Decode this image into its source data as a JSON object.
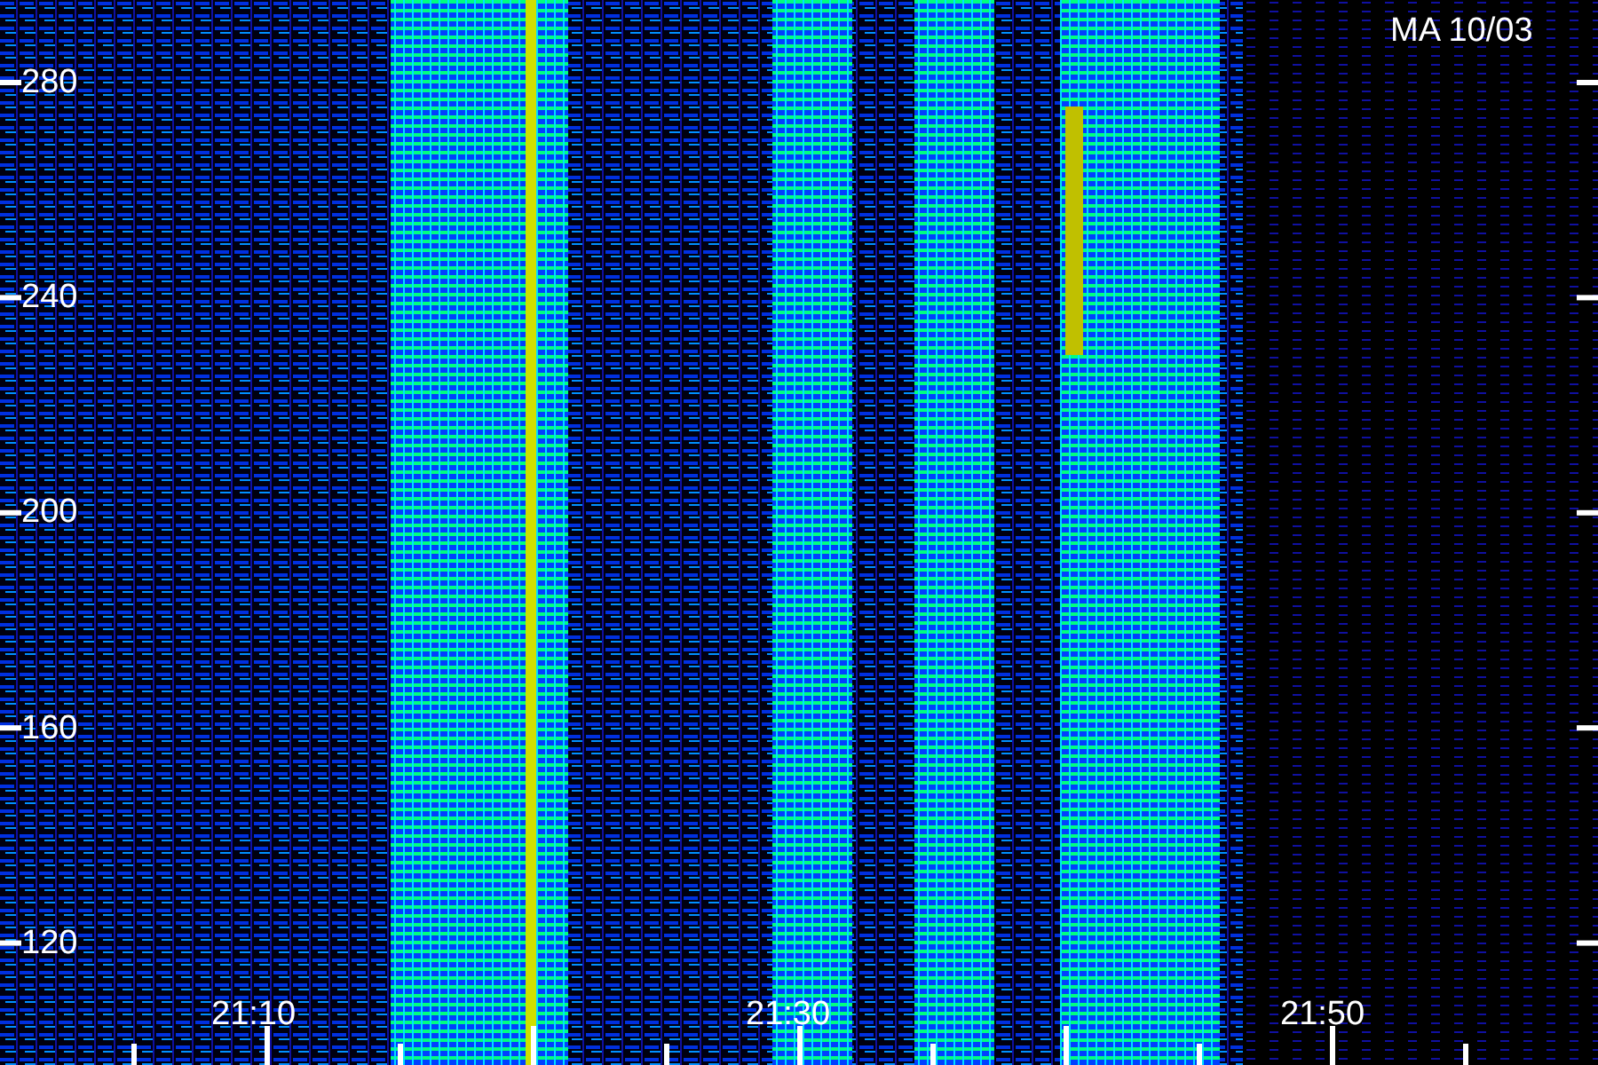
{
  "title": "MA 10/03",
  "y_axis": {
    "labels": [
      "280",
      "240",
      "200",
      "160",
      "120"
    ]
  },
  "x_axis": {
    "labels": [
      "21:10",
      "21:30",
      "21:50"
    ]
  }
}
